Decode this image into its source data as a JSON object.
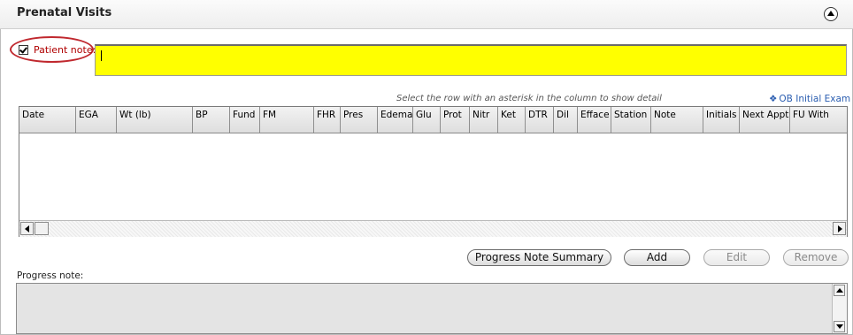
{
  "section": {
    "title": "Prenatal Visits",
    "collapse_icon": "chevron-up-circle-icon"
  },
  "patient_note": {
    "checked": true,
    "label": "Patient note:",
    "value": "",
    "highlight_color": "#ffff00",
    "label_color": "#b00000"
  },
  "grid": {
    "hint": "Select the row with an asterisk in the column to show detail",
    "ob_link": "OB Initial Exam",
    "columns": [
      "Date",
      "EGA",
      "Wt (lb)",
      "BP",
      "Fund",
      "FM",
      "FHR",
      "Pres",
      "Edema",
      "Glu",
      "Prot",
      "Nitr",
      "Ket",
      "DTR",
      "Dil",
      "Efface",
      "Station",
      "Note",
      "Initials",
      "Next Appt",
      "FU With"
    ],
    "rows": []
  },
  "actions": {
    "progress_note_summary": "Progress Note Summary",
    "add": "Add",
    "edit": "Edit",
    "remove": "Remove"
  },
  "progress_note": {
    "label": "Progress note:",
    "value": ""
  }
}
